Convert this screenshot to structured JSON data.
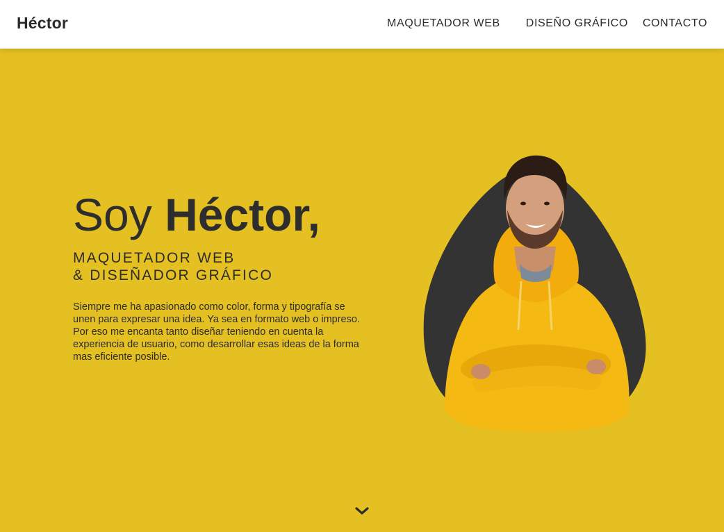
{
  "nav": {
    "brand": "Héctor",
    "items": [
      {
        "label": "MAQUETADOR WEB"
      },
      {
        "label": "DISEÑO GRÁFICO"
      },
      {
        "label": "CONTACTO"
      }
    ]
  },
  "hero": {
    "greeting": "Soy",
    "name": "Héctor,",
    "subtitle_line1": "MAQUETADOR WEB",
    "subtitle_line2": "& DISEÑADOR GRÁFICO",
    "description": "Siempre me ha apasionado como color, forma y tipografía se unen para expresar una idea. Ya sea en formato web o impreso. Por eso me encanta tanto diseñar teniendo en cuenta la experiencia de usuario, como desarrollar esas ideas de la forma mas eficiente posible.",
    "scroll_icon": "chevron-down-icon"
  },
  "colors": {
    "accent": "#e5c022",
    "text": "#2d2d2d",
    "nav_bg": "#ffffff",
    "blob": "#333333",
    "hoodie": "#f5b914"
  }
}
